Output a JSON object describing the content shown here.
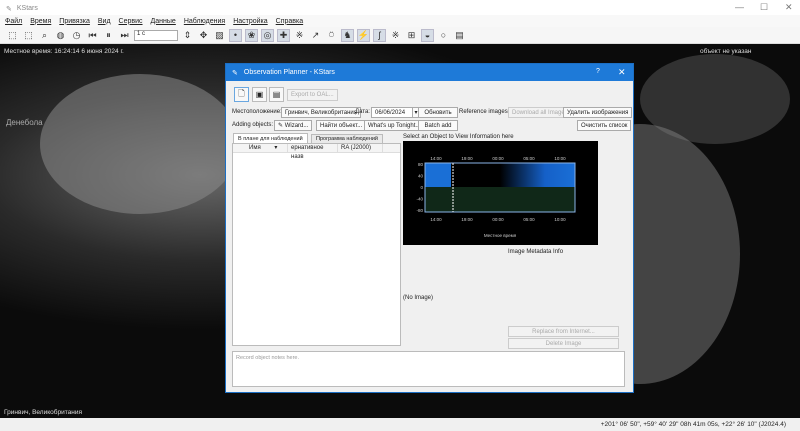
{
  "app": {
    "title": "KStars"
  },
  "menu": [
    "Файл",
    "Время",
    "Привязка",
    "Вид",
    "Сервис",
    "Данные",
    "Наблюдения",
    "Настройка",
    "Справка"
  ],
  "toolbar": {
    "time_step": "1 с"
  },
  "sky": {
    "local_time": "Местное время: 16:24:14  6 июня 2024 г.",
    "object": "объект не указан",
    "star_label": "Денебола",
    "location": "Гринвич, Великобритания"
  },
  "status": {
    "coords": "+201° 06' 50\", +59° 40' 29\"  08h 41m 05s, +22° 26' 10\" (J2024.4)"
  },
  "dialog": {
    "title": "Observation Planner - KStars",
    "export": "Export to OAL...",
    "location_label": "Местоположение:",
    "location": "Гринвич, Великобритания",
    "date_label": "Дата:",
    "date": "06/06/2024",
    "refresh": "Обновить",
    "ref_label": "Reference images:",
    "download": "Download all Images",
    "delete_images": "Удалить изображения",
    "adding_label": "Adding objects:",
    "wizard": "Wizard...",
    "find": "Найти объект...",
    "whats_up": "What's up Tonight...",
    "batch": "Batch add",
    "clear": "Очистить список",
    "tabs": [
      "В плане для наблюдений",
      "Программа наблюдений"
    ],
    "columns": [
      "Имя",
      "ернативное назв",
      "RA (J2000)"
    ],
    "select_hint": "Select an Object to View Information here",
    "chart_xticks": [
      "14:00",
      "19:00",
      "00:00",
      "05:00",
      "10:00"
    ],
    "chart_yticks": [
      "80",
      "40",
      "0",
      "-40",
      "-80"
    ],
    "chart_xlabel": "Местное время",
    "metadata": "Image Metadata Info",
    "no_image": "(No Image)",
    "replace": "Replace from Internet...",
    "delete_image": "Delete Image",
    "notes_placeholder": "Record object notes here."
  }
}
